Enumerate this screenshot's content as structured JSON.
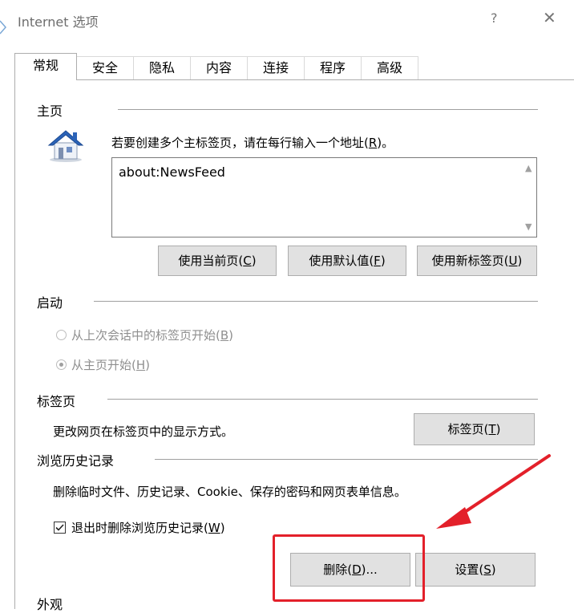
{
  "window": {
    "title": "Internet 选项",
    "help_glyph": "?",
    "close_glyph": "✕"
  },
  "tabs": [
    {
      "label": "常规",
      "active": true
    },
    {
      "label": "安全",
      "active": false
    },
    {
      "label": "隐私",
      "active": false
    },
    {
      "label": "内容",
      "active": false
    },
    {
      "label": "连接",
      "active": false
    },
    {
      "label": "程序",
      "active": false
    },
    {
      "label": "高级",
      "active": false
    }
  ],
  "home": {
    "heading": "主页",
    "instruction_pre": "若要创建多个主标签页，请在每行输入一个地址(",
    "instruction_key": "R",
    "instruction_post": ")。",
    "address": "about:NewsFeed",
    "buttons": [
      {
        "pre": "使用当前页(",
        "key": "C",
        "post": ")"
      },
      {
        "pre": "使用默认值(",
        "key": "F",
        "post": ")"
      },
      {
        "pre": "使用新标签页(",
        "key": "U",
        "post": ")"
      }
    ]
  },
  "startup": {
    "heading": "启动",
    "options": [
      {
        "pre": "从上次会话中的标签页开始(",
        "key": "B",
        "post": ")",
        "checked": false
      },
      {
        "pre": "从主页开始(",
        "key": "H",
        "post": ")",
        "checked": true
      }
    ]
  },
  "tabs_section": {
    "heading": "标签页",
    "description": "更改网页在标签页中的显示方式。",
    "button": {
      "pre": "标签页(",
      "key": "T",
      "post": ")"
    }
  },
  "history": {
    "heading": "浏览历史记录",
    "description": "删除临时文件、历史记录、Cookie、保存的密码和网页表单信息。",
    "checkbox": {
      "pre": "退出时删除浏览历史记录(",
      "key": "W",
      "post": ")",
      "checked": true
    },
    "delete_button": {
      "pre": "删除(",
      "key": "D",
      "post": ")..."
    },
    "settings_button": {
      "pre": "设置(",
      "key": "S",
      "post": ")"
    }
  },
  "appearance": {
    "heading": "外观"
  },
  "colors": {
    "annotation": "#e3202a",
    "house_roof": "#2b63b8",
    "house_wall": "#e8eef7"
  }
}
